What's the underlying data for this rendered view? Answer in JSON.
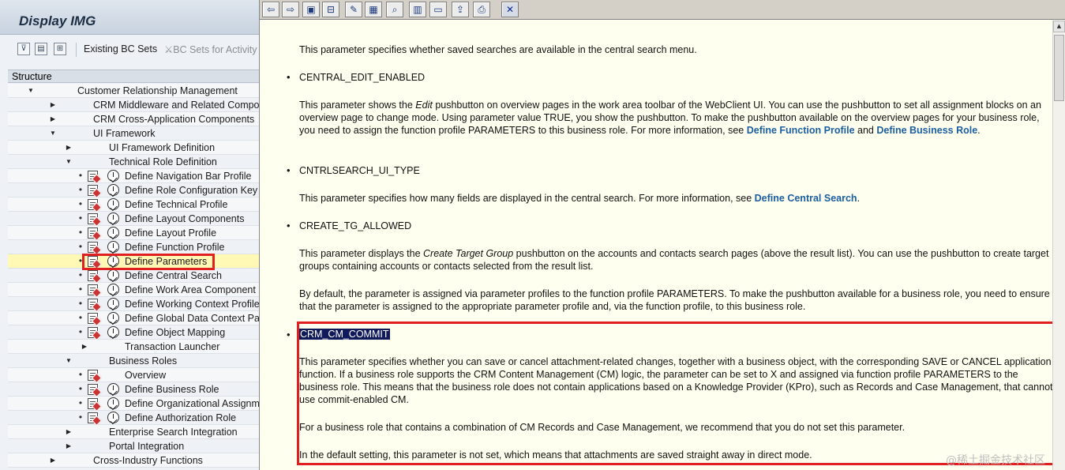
{
  "left_pane": {
    "title": "Display IMG",
    "toolbar": {
      "existing_bc_sets": "Existing BC Sets",
      "bc_sets_activity": "BC Sets for Activity"
    },
    "structure_header": "Structure",
    "tree": [
      {
        "label": "Customer Relationship Management",
        "level": 0,
        "toggle": "expanded",
        "icons": false
      },
      {
        "label": "CRM Middleware and Related Components",
        "level": 1,
        "toggle": "collapsed",
        "icons": false
      },
      {
        "label": "CRM Cross-Application Components",
        "level": 1,
        "toggle": "collapsed",
        "icons": false
      },
      {
        "label": "UI Framework",
        "level": 1,
        "toggle": "expanded",
        "icons": false
      },
      {
        "label": "UI Framework Definition",
        "level": 2,
        "toggle": "collapsed",
        "icons": false
      },
      {
        "label": "Technical Role Definition",
        "level": 2,
        "toggle": "expanded",
        "icons": false
      },
      {
        "label": "Define Navigation Bar Profile",
        "level": 3,
        "toggle": "leaf",
        "icons": true
      },
      {
        "label": "Define Role Configuration Key",
        "level": 3,
        "toggle": "leaf",
        "icons": true
      },
      {
        "label": "Define Technical Profile",
        "level": 3,
        "toggle": "leaf",
        "icons": true
      },
      {
        "label": "Define Layout Components",
        "level": 3,
        "toggle": "leaf",
        "icons": true
      },
      {
        "label": "Define Layout Profile",
        "level": 3,
        "toggle": "leaf",
        "icons": true
      },
      {
        "label": "Define Function Profile",
        "level": 3,
        "toggle": "leaf",
        "icons": true
      },
      {
        "label": "Define Parameters",
        "level": 3,
        "toggle": "leaf",
        "icons": true,
        "selected": true
      },
      {
        "label": "Define Central Search",
        "level": 3,
        "toggle": "leaf",
        "icons": true
      },
      {
        "label": "Define Work Area Component",
        "level": 3,
        "toggle": "leaf",
        "icons": true
      },
      {
        "label": "Define Working Context Profile",
        "level": 3,
        "toggle": "leaf",
        "icons": true
      },
      {
        "label": "Define Global Data Context Parameters",
        "level": 3,
        "toggle": "leaf",
        "icons": true
      },
      {
        "label": "Define Object Mapping",
        "level": 3,
        "toggle": "leaf",
        "icons": true
      },
      {
        "label": "Transaction Launcher",
        "level": 3,
        "toggle": "collapsed",
        "icons": false
      },
      {
        "label": "Business Roles",
        "level": 2,
        "toggle": "expanded",
        "icons": false
      },
      {
        "label": "Overview",
        "level": 3,
        "toggle": "leaf",
        "icons": "doc-only"
      },
      {
        "label": "Define Business Role",
        "level": 3,
        "toggle": "leaf",
        "icons": true
      },
      {
        "label": "Define Organizational Assignment",
        "level": 3,
        "toggle": "leaf",
        "icons": true
      },
      {
        "label": "Define Authorization Role",
        "level": 3,
        "toggle": "leaf",
        "icons": true
      },
      {
        "label": "Enterprise Search Integration",
        "level": 2,
        "toggle": "collapsed",
        "icons": false
      },
      {
        "label": "Portal Integration",
        "level": 2,
        "toggle": "collapsed",
        "icons": false
      },
      {
        "label": "Cross-Industry Functions",
        "level": 1,
        "toggle": "collapsed",
        "icons": false
      }
    ]
  },
  "right_pane": {
    "toolbar_icons": [
      "back-icon",
      "forward-icon",
      "book-icon",
      "structure-icon",
      "edit-icon",
      "notes-icon",
      "find-icon",
      "table-icon",
      "window-icon",
      "export-icon",
      "print-icon",
      "close-icon"
    ],
    "doc": {
      "saved_search_text": "This parameter specifies whether saved searches are available in the central search menu.",
      "central_edit": {
        "name": "CENTRAL_EDIT_ENABLED",
        "text_before_edit": "This parameter shows the ",
        "edit_word": "Edit",
        "text_after_edit": " pushbutton on overview pages in the work area toolbar of the WebClient UI. You can use the pushbutton to set all assignment blocks on an overview page to change mode. Using parameter value TRUE, you show the pushbutton. To make the pushbutton available on the overview pages for your business role, you need to assign the function profile PARAMETERS to this business role. For more information, see ",
        "link1": "Define Function Profile",
        "and_word": " and ",
        "link2": "Define Business Role",
        "end": "."
      },
      "cntrlsearch": {
        "name": "CNTRLSEARCH_UI_TYPE",
        "text": "This parameter specifies how many fields are displayed in the central search. For more information, see ",
        "link": "Define Central Search",
        "end": "."
      },
      "create_tg": {
        "name": "CREATE_TG_ALLOWED",
        "text1_before": "This parameter displays the ",
        "text1_italic": "Create Target Group",
        "text1_after": " pushbutton on the accounts and contacts search pages (above the result list). You can use the pushbutton to create target groups containing accounts or contacts selected from the result list.",
        "text2": "By default, the parameter is assigned via parameter profiles to the function profile PARAMETERS. To make the pushbutton available for a business role, you need to ensure that the parameter is assigned to the appropriate parameter profile and, via the function profile, to this business role."
      },
      "crm_cm_commit": {
        "name": "CRM_CM_COMMIT",
        "text1": "This parameter specifies whether you can save or cancel attachment-related changes, together with a business object, with the corresponding SAVE or CANCEL application function. If a business role supports the CRM Content Management (CM) logic, the parameter can be set to X and assigned via function profile PARAMETERS to the business role. This means that the business role does not contain applications based on a Knowledge Provider (KPro), such as Records and Case Management, that cannot use commit-enabled CM.",
        "text2": "For a business role that contains a combination of CM Records and Case Management, we recommend that you do not set this parameter.",
        "text3": "In the default setting, this parameter is not set, which means that attachments are saved straight away in direct mode."
      }
    },
    "watermark": "@稀土掘金技术社区"
  }
}
